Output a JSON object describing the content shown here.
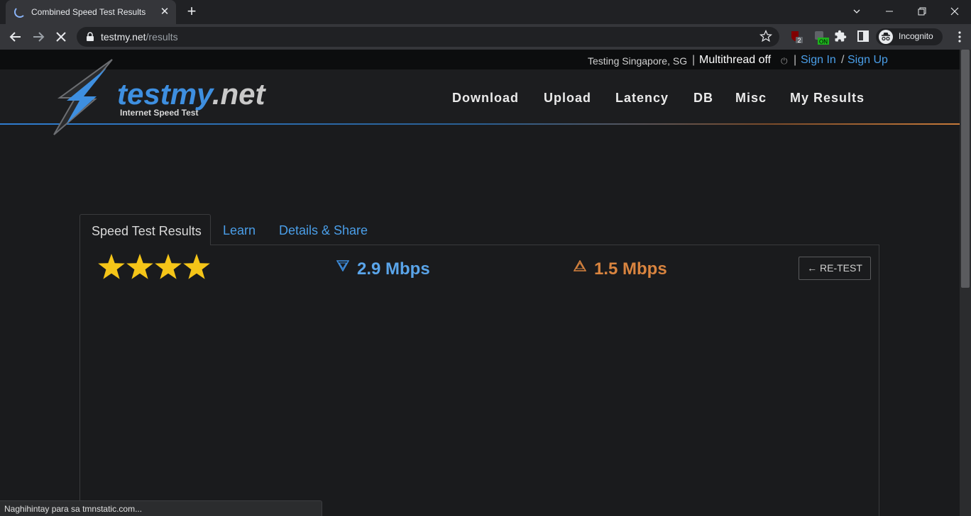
{
  "browser": {
    "tab_title": "Combined Speed Test Results",
    "url_host": "testmy.net",
    "url_path": "/results",
    "profile_label": "Incognito",
    "extension_badges": [
      "2",
      "ON"
    ]
  },
  "site": {
    "topbar": {
      "testing": "Testing Singapore, SG",
      "sep1": "|",
      "multithread": "Multithread off",
      "sep2": "|",
      "sign_in": "Sign In",
      "slash": "/",
      "sign_up": "Sign Up"
    },
    "logo_text": "testmy",
    "logo_dot": ".net",
    "logo_sub": "Internet Speed Test",
    "nav": [
      "Download",
      "Upload",
      "Latency",
      "DB",
      "Misc",
      "My Results"
    ]
  },
  "results": {
    "tabs": [
      "Speed Test Results",
      "Learn",
      "Details & Share"
    ],
    "stars": 4,
    "download": "2.9 Mbps",
    "upload": "1.5 Mbps",
    "retest": "← RE-TEST"
  },
  "status_text": "Naghihintay para sa tmnstatic.com...",
  "colors": {
    "download": "#5aa5ea",
    "upload": "#d9843f",
    "link": "#4a9ee8",
    "star": "#f5c518"
  }
}
